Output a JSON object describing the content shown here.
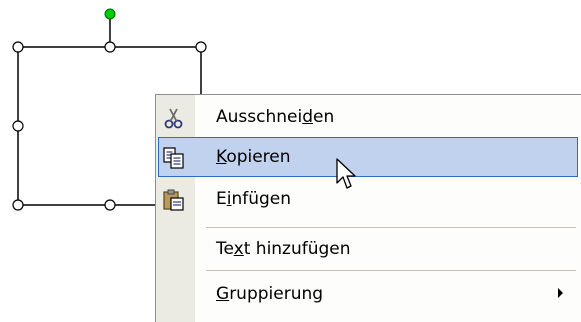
{
  "canvas": {
    "shape": "rectangle-with-selection-handles",
    "handle_color": "#ffffff",
    "rotate_handle_color": "#00cc00"
  },
  "context_menu": {
    "items": [
      {
        "name": "cut",
        "pre": "Ausschnei",
        "accel": "d",
        "post": "en",
        "icon": "scissors-icon",
        "selected": false
      },
      {
        "name": "copy",
        "pre": "",
        "accel": "K",
        "post": "opieren",
        "icon": "copy-icon",
        "selected": true
      },
      {
        "name": "paste",
        "pre": "E",
        "accel": "i",
        "post": "nfügen",
        "icon": "paste-icon",
        "selected": false
      },
      {
        "name": "add-text",
        "pre": "Te",
        "accel": "x",
        "post": "t hinzufügen",
        "icon": null,
        "selected": false
      },
      {
        "name": "grouping",
        "pre": "",
        "accel": "G",
        "post": "ruppierung",
        "icon": null,
        "selected": false,
        "submenu": true
      }
    ],
    "colors": {
      "gutter": "#ecebe3",
      "highlight_fill": "#c1d2ee",
      "highlight_border": "#316ac5",
      "background": "#fdfdfb"
    }
  }
}
